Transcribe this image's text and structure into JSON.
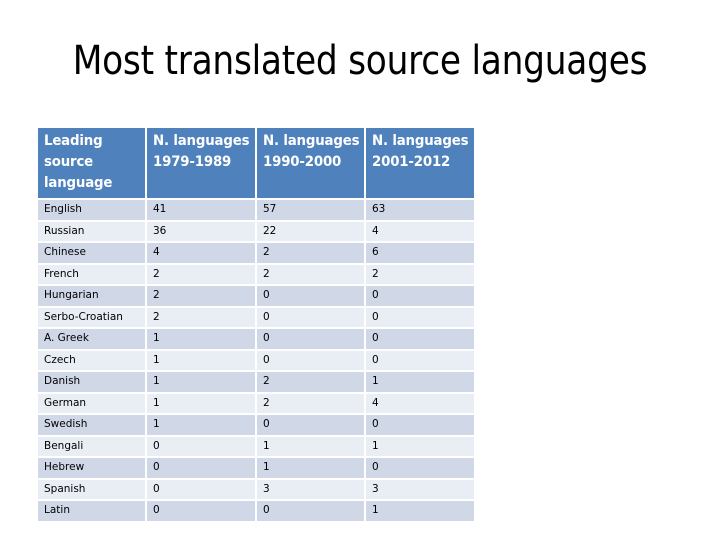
{
  "slide": {
    "title": "Most translated source languages"
  },
  "table": {
    "headers": [
      [
        "Leading",
        "source",
        "language"
      ],
      [
        "N. languages",
        "1979-1989"
      ],
      [
        "N. languages",
        "1990-2000"
      ],
      [
        "N. languages",
        "2001-2012"
      ]
    ],
    "rows": [
      [
        "English",
        "41",
        "57",
        "63"
      ],
      [
        "Russian",
        "36",
        "22",
        "4"
      ],
      [
        "Chinese",
        "4",
        "2",
        "6"
      ],
      [
        "French",
        "2",
        "2",
        "2"
      ],
      [
        "Hungarian",
        "2",
        "0",
        "0"
      ],
      [
        "Serbo-Croatian",
        "2",
        "0",
        "0"
      ],
      [
        "A. Greek",
        "1",
        "0",
        "0"
      ],
      [
        "Czech",
        "1",
        "0",
        "0"
      ],
      [
        "Danish",
        "1",
        "2",
        "1"
      ],
      [
        "German",
        "1",
        "2",
        "4"
      ],
      [
        "Swedish",
        "1",
        "0",
        "0"
      ],
      [
        "Bengali",
        "0",
        "1",
        "1"
      ],
      [
        "Hebrew",
        "0",
        "1",
        "0"
      ],
      [
        "Spanish",
        "0",
        "3",
        "3"
      ],
      [
        "Latin",
        "0",
        "0",
        "1"
      ]
    ]
  },
  "colors": {
    "header_bg": "#4f81bd",
    "row_odd_bg": "#d0d8e8",
    "row_even_bg": "#e9edf4"
  }
}
